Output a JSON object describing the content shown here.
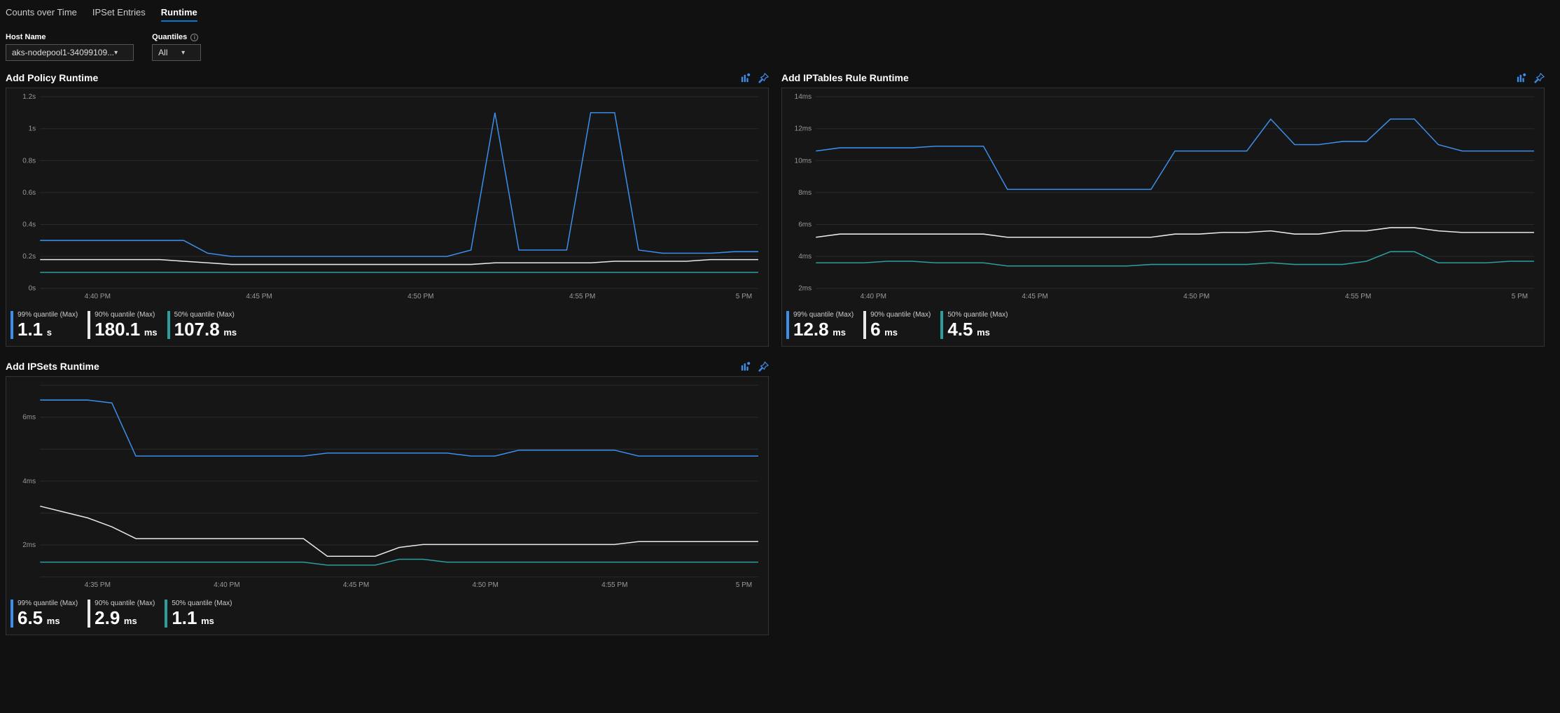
{
  "tabs": {
    "items": [
      "Counts over Time",
      "IPSet Entries",
      "Runtime"
    ],
    "active_index": 2
  },
  "filters": {
    "hostname_label": "Host Name",
    "hostname_value": "aks-nodepool1-34099109...",
    "quantiles_label": "Quantiles",
    "quantiles_value": "All"
  },
  "colors": {
    "q99": "#3b8eea",
    "q90": "#e8e8e8",
    "q50": "#2d9d9d",
    "accent": "#0078d4"
  },
  "series_legend_labels": {
    "q99": "99% quantile (Max)",
    "q90": "90% quantile (Max)",
    "q50": "50% quantile (Max)"
  },
  "chart_data": [
    {
      "id": "add_policy",
      "title": "Add Policy Runtime",
      "type": "line",
      "x_ticks": [
        "4:40 PM",
        "4:45 PM",
        "4:50 PM",
        "4:55 PM",
        "5 PM"
      ],
      "ylabel": "",
      "y_ticks": [
        "0s",
        "0.2s",
        "0.4s",
        "0.6s",
        "0.8s",
        "1s",
        "1.2s"
      ],
      "ylim": [
        0,
        1.2
      ],
      "x_count": 31,
      "series": [
        {
          "name": "q99",
          "values": [
            0.3,
            0.3,
            0.3,
            0.3,
            0.3,
            0.3,
            0.3,
            0.22,
            0.2,
            0.2,
            0.2,
            0.2,
            0.2,
            0.2,
            0.2,
            0.2,
            0.2,
            0.2,
            0.24,
            1.1,
            0.24,
            0.24,
            0.24,
            1.1,
            1.1,
            0.24,
            0.22,
            0.22,
            0.22,
            0.23,
            0.23
          ]
        },
        {
          "name": "q90",
          "values": [
            0.18,
            0.18,
            0.18,
            0.18,
            0.18,
            0.18,
            0.17,
            0.16,
            0.15,
            0.15,
            0.15,
            0.15,
            0.15,
            0.15,
            0.15,
            0.15,
            0.15,
            0.15,
            0.15,
            0.16,
            0.16,
            0.16,
            0.16,
            0.16,
            0.17,
            0.17,
            0.17,
            0.17,
            0.18,
            0.18,
            0.18
          ]
        },
        {
          "name": "q50",
          "values": [
            0.1,
            0.1,
            0.1,
            0.1,
            0.1,
            0.1,
            0.1,
            0.1,
            0.1,
            0.1,
            0.1,
            0.1,
            0.1,
            0.1,
            0.1,
            0.1,
            0.1,
            0.1,
            0.1,
            0.1,
            0.1,
            0.1,
            0.1,
            0.1,
            0.1,
            0.1,
            0.1,
            0.1,
            0.1,
            0.1,
            0.1
          ]
        }
      ],
      "summary": {
        "q99": {
          "val": "1.1",
          "unit": "s"
        },
        "q90": {
          "val": "180.1",
          "unit": "ms"
        },
        "q50": {
          "val": "107.8",
          "unit": "ms"
        }
      }
    },
    {
      "id": "add_iptables",
      "title": "Add IPTables Rule Runtime",
      "type": "line",
      "x_ticks": [
        "4:40 PM",
        "4:45 PM",
        "4:50 PM",
        "4:55 PM",
        "5 PM"
      ],
      "ylabel": "",
      "y_ticks": [
        "2ms",
        "4ms",
        "6ms",
        "8ms",
        "10ms",
        "12ms",
        "14ms"
      ],
      "ylim": [
        2,
        14
      ],
      "x_count": 31,
      "series": [
        {
          "name": "q99",
          "values": [
            10.6,
            10.8,
            10.8,
            10.8,
            10.8,
            10.9,
            10.9,
            10.9,
            8.2,
            8.2,
            8.2,
            8.2,
            8.2,
            8.2,
            8.2,
            10.6,
            10.6,
            10.6,
            10.6,
            12.6,
            11.0,
            11.0,
            11.2,
            11.2,
            12.6,
            12.6,
            11.0,
            10.6,
            10.6,
            10.6,
            10.6
          ]
        },
        {
          "name": "q90",
          "values": [
            5.2,
            5.4,
            5.4,
            5.4,
            5.4,
            5.4,
            5.4,
            5.4,
            5.2,
            5.2,
            5.2,
            5.2,
            5.2,
            5.2,
            5.2,
            5.4,
            5.4,
            5.5,
            5.5,
            5.6,
            5.4,
            5.4,
            5.6,
            5.6,
            5.8,
            5.8,
            5.6,
            5.5,
            5.5,
            5.5,
            5.5
          ]
        },
        {
          "name": "q50",
          "values": [
            3.6,
            3.6,
            3.6,
            3.7,
            3.7,
            3.6,
            3.6,
            3.6,
            3.4,
            3.4,
            3.4,
            3.4,
            3.4,
            3.4,
            3.5,
            3.5,
            3.5,
            3.5,
            3.5,
            3.6,
            3.5,
            3.5,
            3.5,
            3.7,
            4.3,
            4.3,
            3.6,
            3.6,
            3.6,
            3.7,
            3.7
          ]
        }
      ],
      "summary": {
        "q99": {
          "val": "12.8",
          "unit": "ms"
        },
        "q90": {
          "val": "6",
          "unit": "ms"
        },
        "q50": {
          "val": "4.5",
          "unit": "ms"
        }
      }
    },
    {
      "id": "add_ipsets",
      "title": "Add IPSets Runtime",
      "type": "line",
      "x_ticks": [
        "4:35 PM",
        "4:40 PM",
        "4:45 PM",
        "4:50 PM",
        "4:55 PM",
        "5 PM"
      ],
      "ylabel": "",
      "y_ticks": [
        "",
        "2ms",
        "",
        "4ms",
        "",
        "6ms",
        ""
      ],
      "ylim": [
        0.5,
        7
      ],
      "x_count": 31,
      "series": [
        {
          "name": "q99",
          "values": [
            6.5,
            6.5,
            6.5,
            6.4,
            4.6,
            4.6,
            4.6,
            4.6,
            4.6,
            4.6,
            4.6,
            4.6,
            4.7,
            4.7,
            4.7,
            4.7,
            4.7,
            4.7,
            4.6,
            4.6,
            4.8,
            4.8,
            4.8,
            4.8,
            4.8,
            4.6,
            4.6,
            4.6,
            4.6,
            4.6,
            4.6
          ]
        },
        {
          "name": "q90",
          "values": [
            2.9,
            2.7,
            2.5,
            2.2,
            1.8,
            1.8,
            1.8,
            1.8,
            1.8,
            1.8,
            1.8,
            1.8,
            1.2,
            1.2,
            1.2,
            1.5,
            1.6,
            1.6,
            1.6,
            1.6,
            1.6,
            1.6,
            1.6,
            1.6,
            1.6,
            1.7,
            1.7,
            1.7,
            1.7,
            1.7,
            1.7
          ]
        },
        {
          "name": "q50",
          "values": [
            1.0,
            1.0,
            1.0,
            1.0,
            1.0,
            1.0,
            1.0,
            1.0,
            1.0,
            1.0,
            1.0,
            1.0,
            0.9,
            0.9,
            0.9,
            1.1,
            1.1,
            1.0,
            1.0,
            1.0,
            1.0,
            1.0,
            1.0,
            1.0,
            1.0,
            1.0,
            1.0,
            1.0,
            1.0,
            1.0,
            1.0
          ]
        }
      ],
      "summary": {
        "q99": {
          "val": "6.5",
          "unit": "ms"
        },
        "q90": {
          "val": "2.9",
          "unit": "ms"
        },
        "q50": {
          "val": "1.1",
          "unit": "ms"
        }
      }
    }
  ]
}
